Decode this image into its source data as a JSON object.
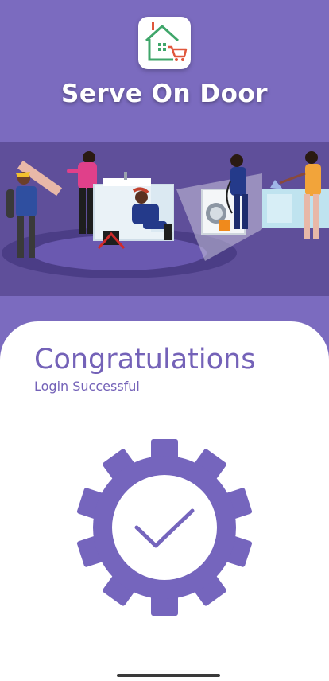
{
  "app": {
    "title": "Serve On Door",
    "logo_icon": "house-cart-logo-icon"
  },
  "hero": {
    "illustration": "home-services-workers-illustration"
  },
  "result": {
    "heading": "Congratulations",
    "message": "Login Successful",
    "icon": "gear-checkmark-icon"
  },
  "colors": {
    "brand": "#7b6bbf",
    "heading_text": "#7462b8",
    "hero_background": "#5f4f9a",
    "sheet_background": "#ffffff"
  }
}
